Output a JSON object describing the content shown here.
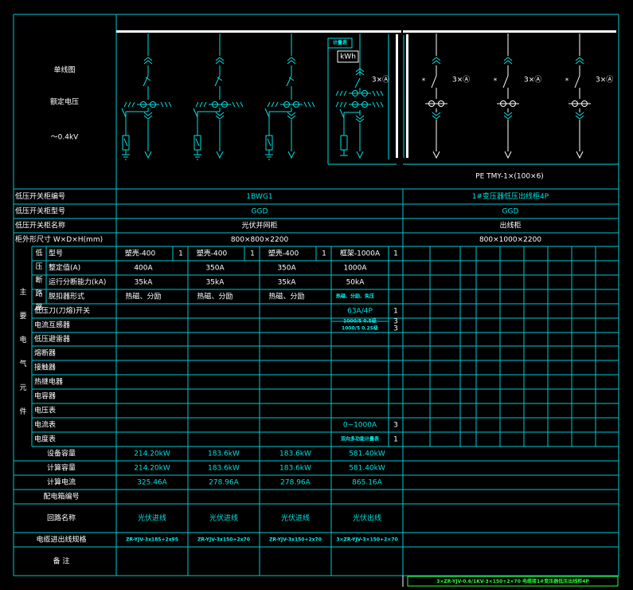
{
  "colors": {
    "background": "#000000",
    "grid": "#00c8d0",
    "text_white": "#ffffff",
    "text_cyan": "#00e0e0",
    "busbar": "#ffffff",
    "note_green": "#2aff2a"
  },
  "left_header": {
    "diagram": "单线图",
    "rated_voltage": "额定电压",
    "voltage_value": "～0.4kV"
  },
  "diagram": {
    "meter_box": "计量表",
    "meter_label": "kWh",
    "ct_labels": [
      "3×Ⓐ",
      "3×Ⓐ",
      "3×Ⓐ",
      "3×Ⓐ"
    ],
    "pe_bus": "PE TMY-1×(100×6)"
  },
  "row_labels": {
    "cabinet_no": "低压开关柜编号",
    "cabinet_type": "低压开关柜型号",
    "cabinet_name": "低压开关柜名称",
    "dimensions": "柜外形尺寸 W×D×H(mm)",
    "main_equipment": "主要电气元件",
    "breaker_group": "低压断路器",
    "model": "型号",
    "rating": "整定值(A)",
    "breaking": "运行分断能力(kA)",
    "trip": "脱扣器形式",
    "knife_switch": "低压刀(刀熔)开关",
    "ct": "电流互感器",
    "arrester": "低压避雷器",
    "fuse": "熔断器",
    "contactor": "接触器",
    "relay": "热继电器",
    "capacitor": "电容器",
    "voltmeter": "电压表",
    "ammeter": "电流表",
    "energy_meter": "电度表",
    "installed_capacity": "设备容量",
    "calc_capacity": "计算容量",
    "calc_current": "计算电流",
    "distribution_no": "配电箱编号",
    "circuit_name": "回路名称",
    "cable": "电缆进出线规格",
    "remarks": "备 注"
  },
  "left_group": {
    "cabinet_no": "1BWG1",
    "cabinet_type": "GGD",
    "cabinet_name": "光伏并网柜",
    "dimensions": "800×800×2200"
  },
  "right_group": {
    "cabinet_no": "1#变压器低压出线柜4P",
    "cabinet_type": "GGD",
    "cabinet_name": "出线柜",
    "dimensions": "800×1000×2200"
  },
  "columns": [
    {
      "model": "塑壳-400",
      "model_qty": "1",
      "rating": "400A",
      "breaking": "35kA",
      "trip": "热磁、分励",
      "capacity": "214.20kW",
      "calc_capacity": "214.20kW",
      "current": "325.46A",
      "circuit": "光伏进线",
      "cable": "ZR-YJV-3x185+2x95"
    },
    {
      "model": "塑壳-400",
      "model_qty": "1",
      "rating": "350A",
      "breaking": "35kA",
      "trip": "热磁、分励",
      "capacity": "183.6kW",
      "calc_capacity": "183.6kW",
      "current": "278.96A",
      "circuit": "光伏进线",
      "cable": "ZR-YJV-3x150+2x70"
    },
    {
      "model": "塑壳-400",
      "model_qty": "1",
      "rating": "350A",
      "breaking": "35kA",
      "trip": "热磁、分励",
      "capacity": "183.6kW",
      "calc_capacity": "183.6kW",
      "current": "278.96A",
      "circuit": "光伏进线",
      "cable": "ZR-YJV-3x150+2x70"
    },
    {
      "model": "框架-1000A",
      "model_qty": "1",
      "rating": "1000A",
      "breaking": "50kA",
      "trip": "热磁、分励、失压",
      "knife_switch": "63A/4P",
      "knife_qty": "1",
      "ct1": "1000/5 0.5级",
      "ct1_qty": "3",
      "ct2": "1000/5 0.2S级",
      "ct2_qty": "3",
      "ammeter": "0~1000A",
      "ammeter_qty": "3",
      "energy_meter": "双向多功能计量表",
      "energy_qty": "1",
      "capacity": "581.40kW",
      "calc_capacity": "581.40kW",
      "current": "865.16A",
      "circuit": "光伏出线",
      "cable": "3×ZR-YJV-3×150+2×70"
    }
  ],
  "bottom_note": "3×ZR-YJV-0.6/1KV-3×150+2×70 电缆接1#变压器低压出线柜4P"
}
